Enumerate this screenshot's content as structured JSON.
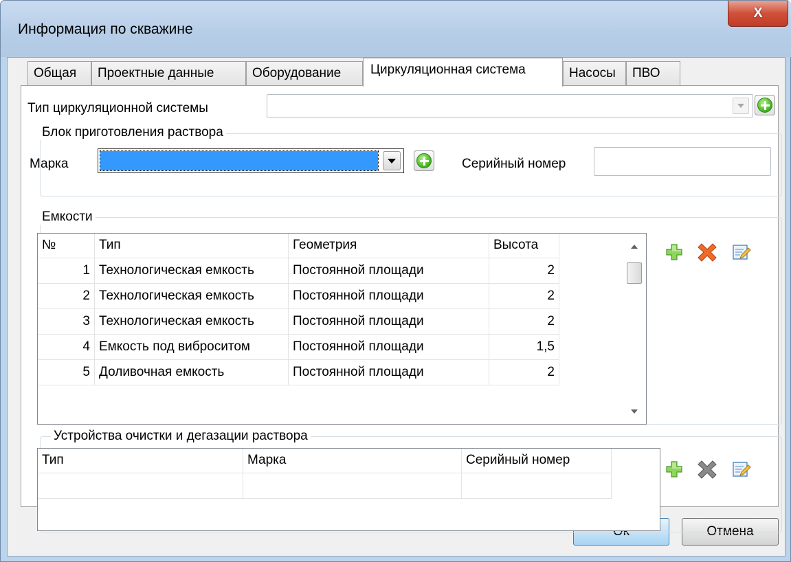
{
  "window": {
    "title": "Информация по скважине",
    "close_glyph": "X"
  },
  "tabs": [
    {
      "label": "Общая"
    },
    {
      "label": "Проектные данные"
    },
    {
      "label": "Оборудование"
    },
    {
      "label": "Циркуляционная система"
    },
    {
      "label": "Насосы"
    },
    {
      "label": "ПВО"
    }
  ],
  "active_tab": "Циркуляционная система",
  "circ_system": {
    "label": "Тип циркуляционной системы",
    "value": ""
  },
  "mix_block": {
    "title": "Блок приготовления раствора",
    "brand_label": "Марка",
    "brand_value": "",
    "serial_label": "Серийный номер",
    "serial_value": ""
  },
  "tanks": {
    "title": "Емкости",
    "columns": [
      "№",
      "Тип",
      "Геометрия",
      "Высота"
    ],
    "rows": [
      {
        "num": "1",
        "type": "Технологическая емкость",
        "geometry": "Постоянной площади",
        "height": "2"
      },
      {
        "num": "2",
        "type": "Технологическая емкость",
        "geometry": "Постоянной площади",
        "height": "2"
      },
      {
        "num": "3",
        "type": "Технологическая емкость",
        "geometry": "Постоянной площади",
        "height": "2"
      },
      {
        "num": "4",
        "type": "Емкость под виброситом",
        "geometry": "Постоянной площади",
        "height": "1,5"
      },
      {
        "num": "5",
        "type": "Доливочная емкость",
        "geometry": "Постоянной площади",
        "height": "2"
      }
    ],
    "tools": [
      "add-icon",
      "delete-icon",
      "edit-icon"
    ]
  },
  "cleaning": {
    "title": "Устройства очистки и дегазации раствора",
    "columns": [
      "Тип",
      "Марка",
      "Серийный номер"
    ],
    "tools": [
      "add-icon",
      "delete-icon-disabled",
      "edit-icon"
    ]
  },
  "buttons": {
    "ok": "Ok",
    "cancel": "Отмена"
  },
  "colors": {
    "selection": "#3399ff",
    "add_green": "#5cbf2a",
    "delete_orange": "#e8581c",
    "delete_gray": "#8a8a8a"
  }
}
